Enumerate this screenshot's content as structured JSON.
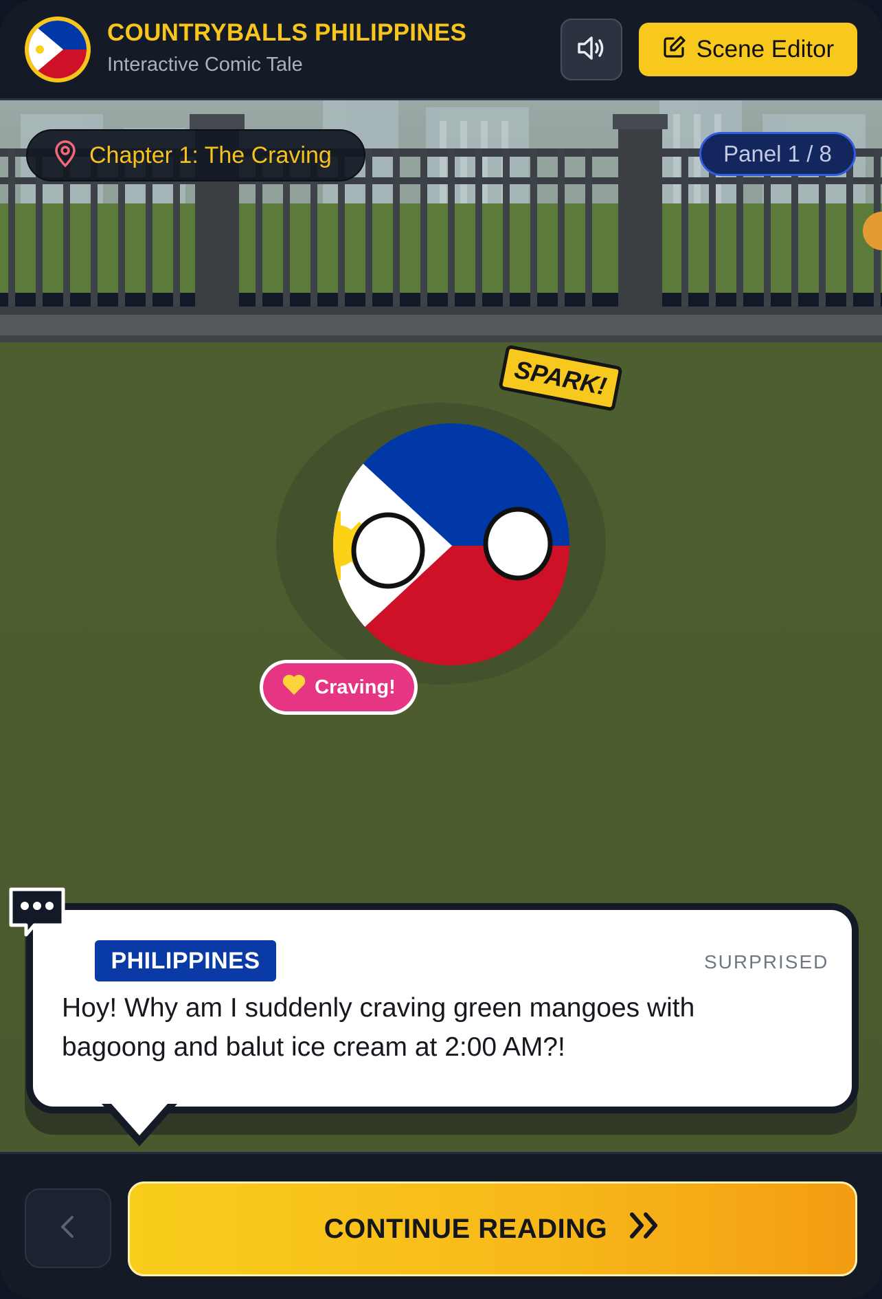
{
  "header": {
    "title": "COUNTRYBALLS PHILIPPINES",
    "subtitle": "Interactive Comic Tale",
    "sound_icon": "speaker-volume-icon",
    "editor_label": "Scene Editor",
    "editor_icon": "edit-icon"
  },
  "scene": {
    "chapter": "Chapter 1: The Craving",
    "chapter_icon": "map-pin-icon",
    "panel_label": "Panel 1 / 8",
    "effect_text": "SPARK!",
    "mood_badge": "Craving!",
    "mood_icon": "heart-icon",
    "character": "philippines-countryball"
  },
  "dialog": {
    "speaker": "PHILIPPINES",
    "emotion": "SURPRISED",
    "text": "Hoy! Why am I suddenly craving green mangoes with bagoong and balut ice cream at 2:00 AM?!",
    "icon": "speech-bubble-icon"
  },
  "footer": {
    "back_icon": "chevron-left-icon",
    "continue_label": "CONTINUE READING",
    "continue_icon": "double-chevron-right-icon"
  },
  "colors": {
    "accent": "#f7c51c",
    "flag_blue": "#0038a8",
    "flag_red": "#ce1126",
    "mood_pink": "#e53583",
    "panel_blue": "#2f5ce0"
  }
}
